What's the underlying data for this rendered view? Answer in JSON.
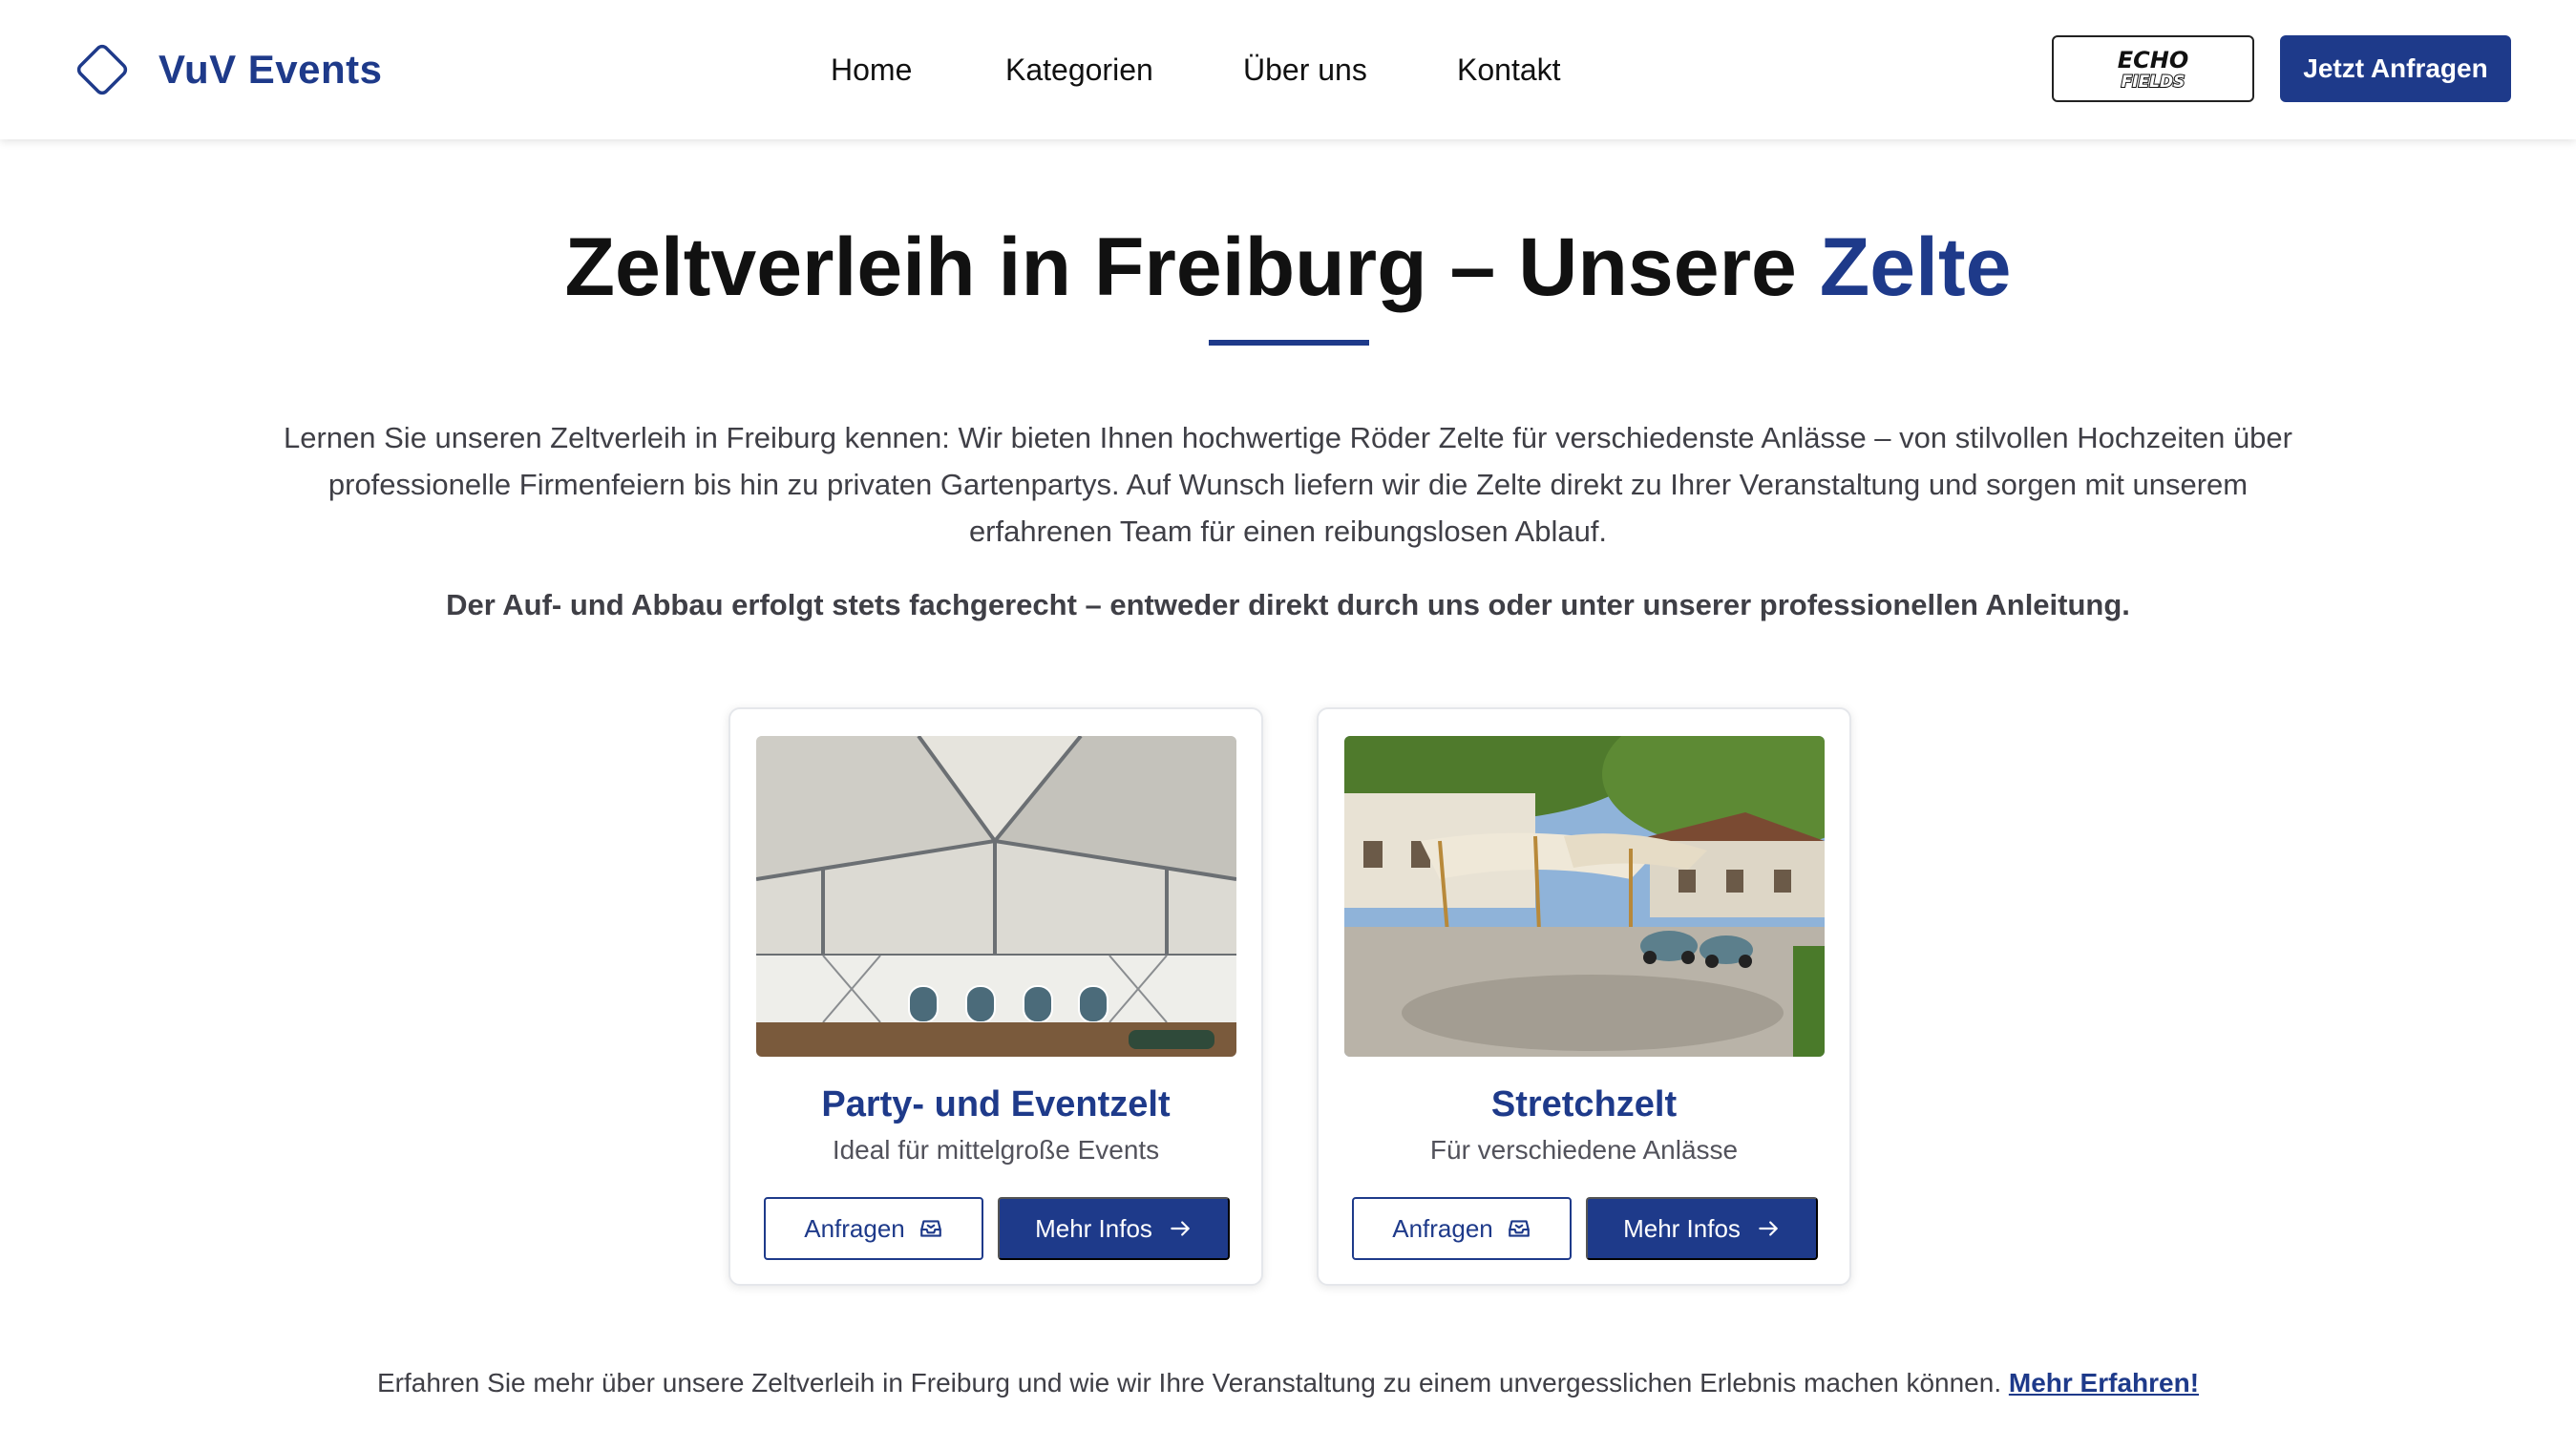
{
  "brand": {
    "name": "VuV Events"
  },
  "nav": {
    "items": [
      "Home",
      "Kategorien",
      "Über uns",
      "Kontakt"
    ]
  },
  "header": {
    "partner_logo": {
      "line1": "ECHO",
      "line2": "FIELDS"
    },
    "cta_label": "Jetzt Anfragen"
  },
  "hero": {
    "title_main": "Zeltverleih in Freiburg – Unsere ",
    "title_accent": "Zelte",
    "intro": "Lernen Sie unseren Zeltverleih in Freiburg kennen: Wir bieten Ihnen hochwertige Röder Zelte für verschiedenste Anlässe – von stilvollen Hochzeiten über professionelle Firmenfeiern bis hin zu privaten Gartenpartys. Auf Wunsch liefern wir die Zelte direkt zu Ihrer Veranstaltung und sorgen mit unserem erfahrenen Team für einen reibungslosen Ablauf.",
    "intro_bold": "Der Auf- und Abbau erfolgt stets fachgerecht – entweder direkt durch uns oder unter unserer professionellen Anleitung."
  },
  "cards": [
    {
      "title": "Party- und Eventzelt",
      "subtitle": "Ideal für mittelgroße Events",
      "inquire_label": "Anfragen",
      "more_label": "Mehr Infos"
    },
    {
      "title": "Stretchzelt",
      "subtitle": "Für verschiedene Anlässe",
      "inquire_label": "Anfragen",
      "more_label": "Mehr Infos"
    }
  ],
  "footer": {
    "text": "Erfahren Sie mehr über unsere Zeltverleih in Freiburg und wie wir Ihre Veranstaltung zu einem unvergesslichen Erlebnis machen können. ",
    "link": "Mehr Erfahren!"
  },
  "colors": {
    "accent": "#1e3a8a",
    "text": "#111111"
  }
}
